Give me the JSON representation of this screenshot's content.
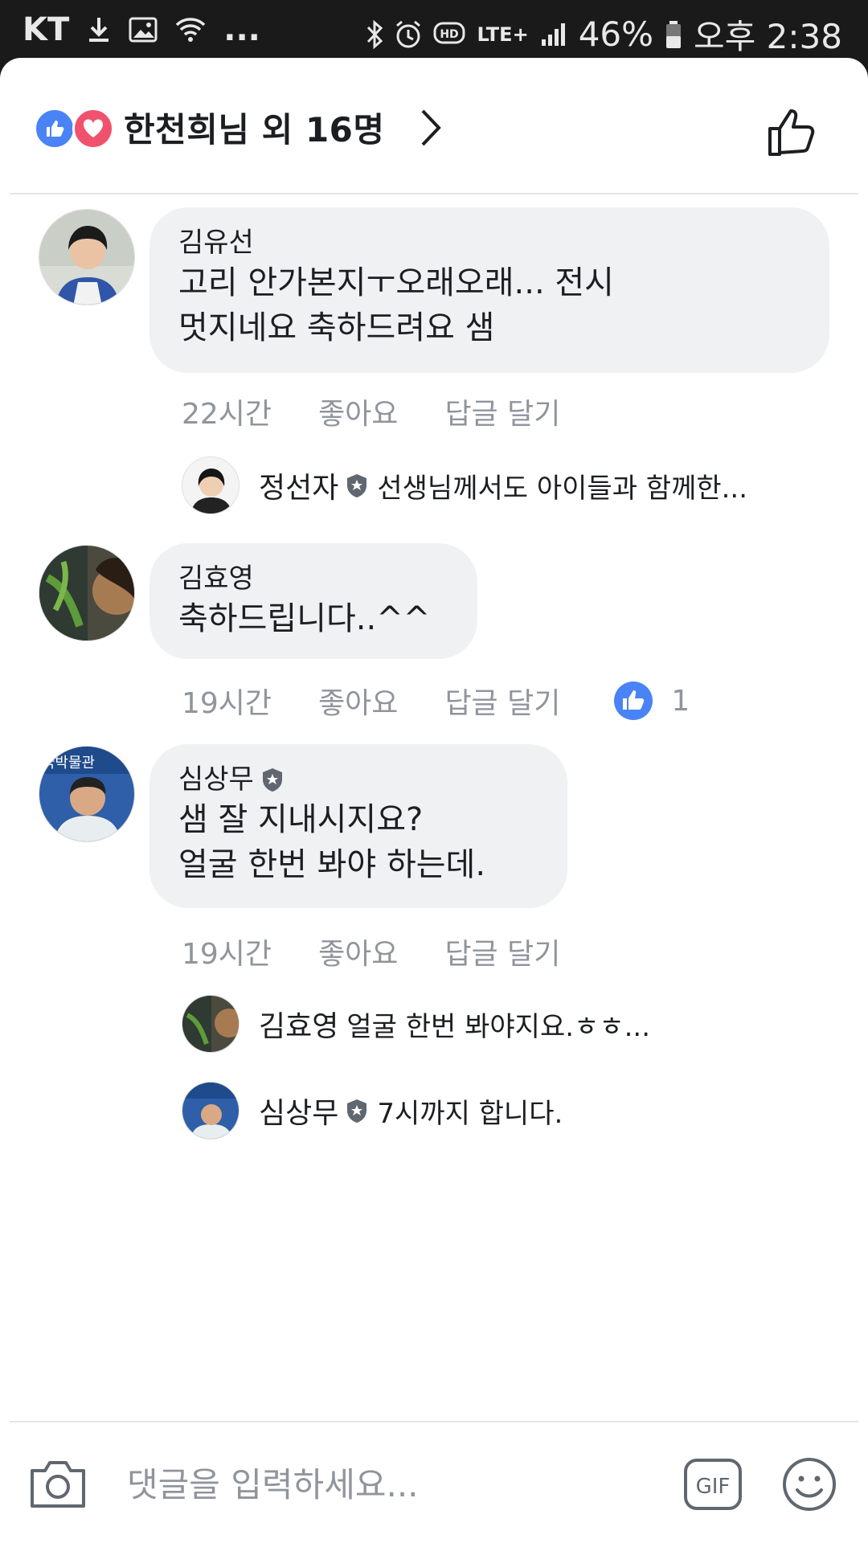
{
  "status_bar": {
    "carrier": "KT",
    "extra": "...",
    "network": "LTE+",
    "battery": "46%",
    "time": "오후 2:38"
  },
  "header": {
    "title": "한천희님 외 16명"
  },
  "comments": [
    {
      "author": "김유선",
      "lines": "고리 안가본지ㅜ오래오래... 전시\n멋지네요 축하드려요 샘",
      "time": "22시간",
      "like": "좋아요",
      "reply": "답글 달기",
      "replies": [
        {
          "author": "정선자",
          "text": "선생님께서도 아이들과 함께한..."
        }
      ]
    },
    {
      "author": "김효영",
      "lines": "축하드립니다..^^",
      "time": "19시간",
      "like": "좋아요",
      "reply": "답글 달기",
      "reaction_count": "1"
    },
    {
      "author": "심상무",
      "lines": "샘 잘 지내시지요?\n얼굴 한번 봐야 하는데.",
      "time": "19시간",
      "like": "좋아요",
      "reply": "답글 달기",
      "avatar_banner": "국박물관",
      "replies": [
        {
          "author": "김효영",
          "text": "얼굴 한번 봐야지요.ㅎㅎ..."
        },
        {
          "author": "심상무",
          "text": "7시까지  합니다."
        }
      ]
    }
  ],
  "composer": {
    "placeholder": "댓글을 입력하세요..."
  },
  "colors": {
    "like_blue": "#4a83f5",
    "love_red": "#f0526e",
    "bubble": "#f0f1f3",
    "meta_gray": "#90949c"
  }
}
